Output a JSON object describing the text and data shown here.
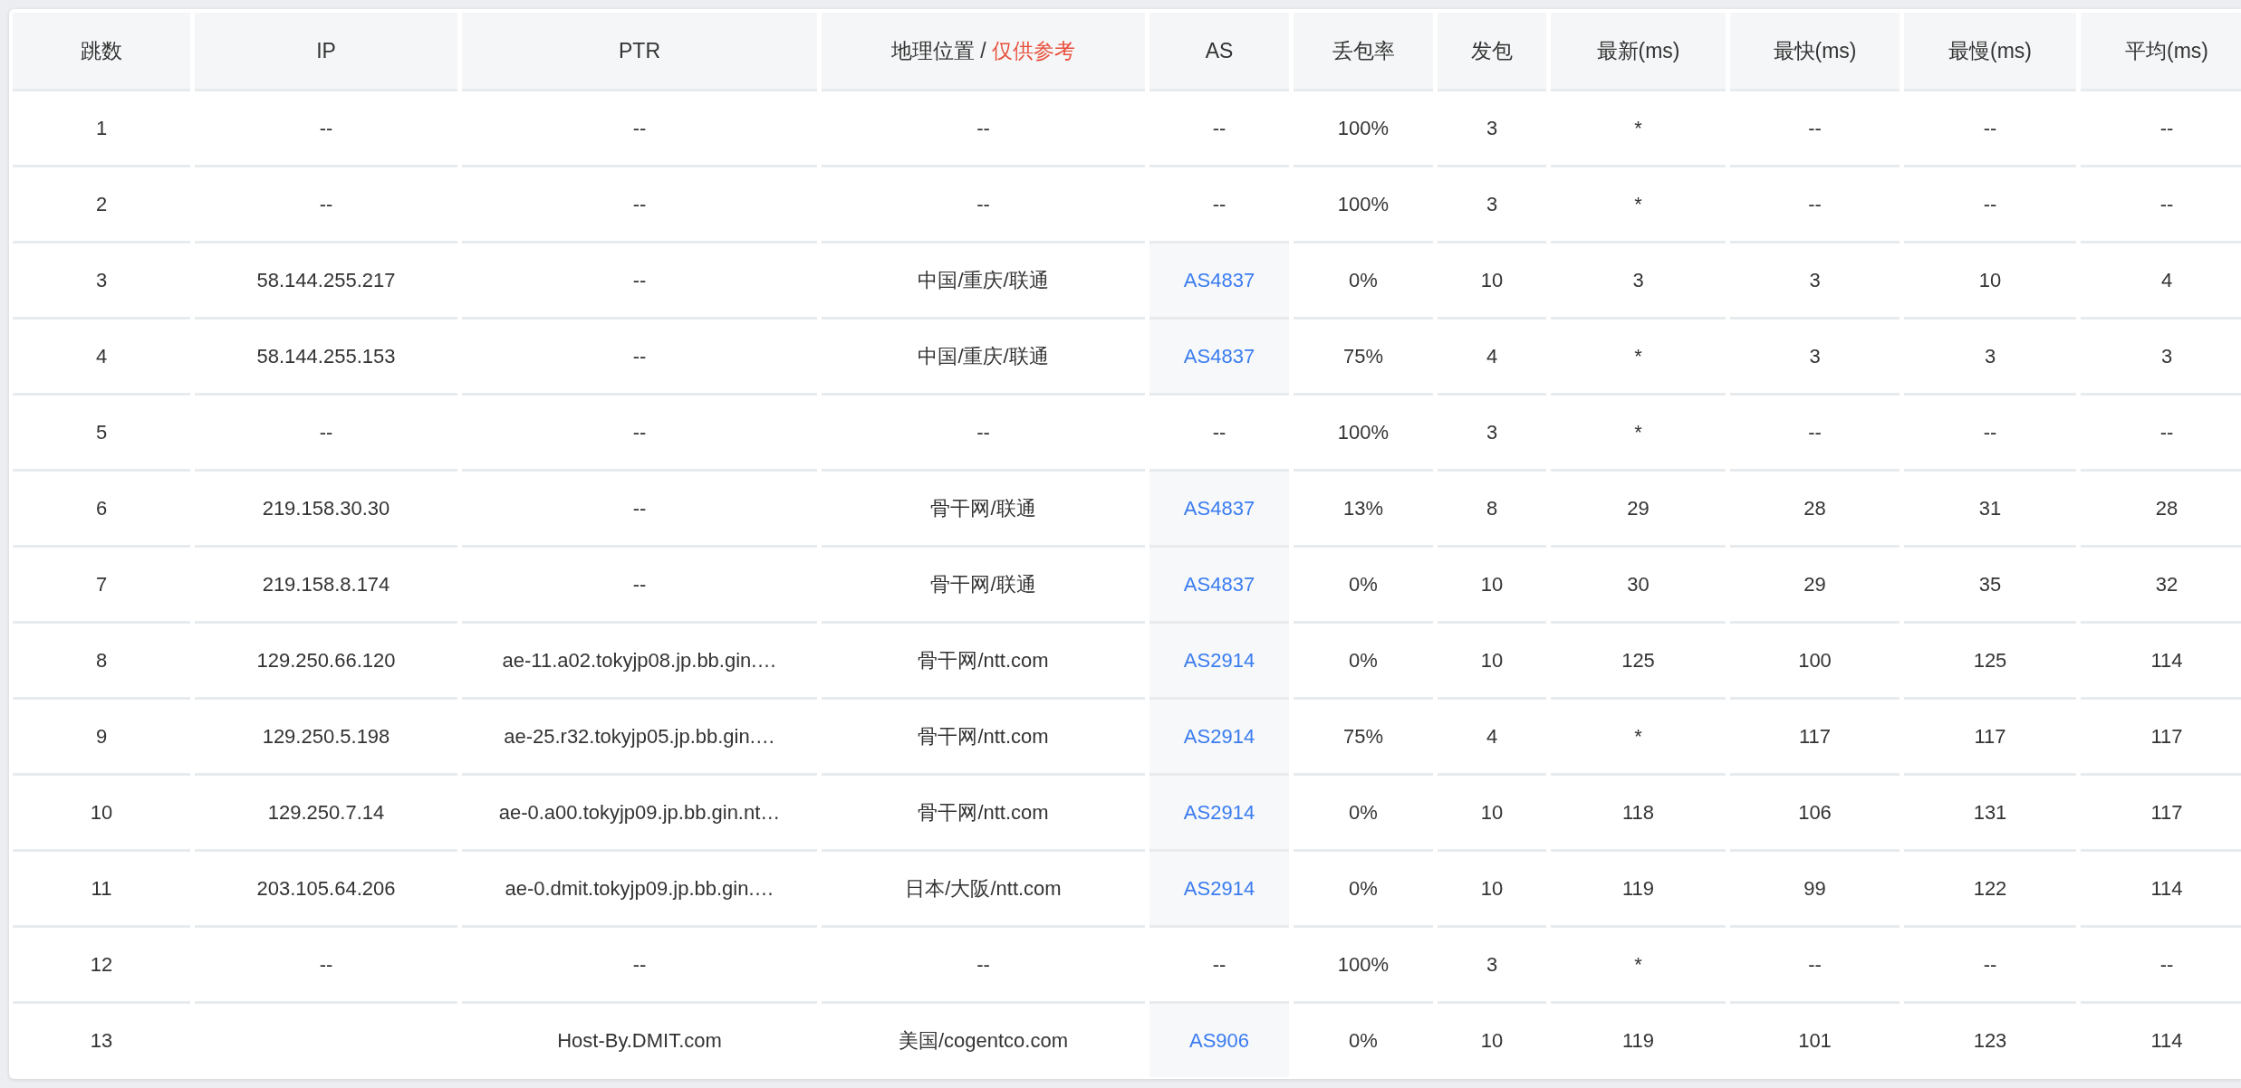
{
  "table": {
    "columns": [
      {
        "label": "跳数"
      },
      {
        "label": "IP"
      },
      {
        "label": "PTR"
      },
      {
        "label": "地理位置 /",
        "note": "仅供参考"
      },
      {
        "label": "AS"
      },
      {
        "label": "丢包率"
      },
      {
        "label": "发包"
      },
      {
        "label": "最新(ms)"
      },
      {
        "label": "最快(ms)"
      },
      {
        "label": "最慢(ms)"
      },
      {
        "label": "平均(ms)"
      }
    ],
    "rows": [
      {
        "hop": "1",
        "ip": "--",
        "ptr": "--",
        "geo": "--",
        "as": {
          "text": "--",
          "link": false
        },
        "loss": "100%",
        "sent": "3",
        "last": "*",
        "best": "--",
        "worst": "--",
        "avg": "--"
      },
      {
        "hop": "2",
        "ip": "--",
        "ptr": "--",
        "geo": "--",
        "as": {
          "text": "--",
          "link": false
        },
        "loss": "100%",
        "sent": "3",
        "last": "*",
        "best": "--",
        "worst": "--",
        "avg": "--"
      },
      {
        "hop": "3",
        "ip": "58.144.255.217",
        "ptr": "--",
        "geo": "中国/重庆/联通",
        "as": {
          "text": "AS4837",
          "link": true
        },
        "loss": "0%",
        "sent": "10",
        "last": "3",
        "best": "3",
        "worst": "10",
        "avg": "4"
      },
      {
        "hop": "4",
        "ip": "58.144.255.153",
        "ptr": "--",
        "geo": "中国/重庆/联通",
        "as": {
          "text": "AS4837",
          "link": true
        },
        "loss": "75%",
        "sent": "4",
        "last": "*",
        "best": "3",
        "worst": "3",
        "avg": "3"
      },
      {
        "hop": "5",
        "ip": "--",
        "ptr": "--",
        "geo": "--",
        "as": {
          "text": "--",
          "link": false
        },
        "loss": "100%",
        "sent": "3",
        "last": "*",
        "best": "--",
        "worst": "--",
        "avg": "--"
      },
      {
        "hop": "6",
        "ip": "219.158.30.30",
        "ptr": "--",
        "geo": "骨干网/联通",
        "as": {
          "text": "AS4837",
          "link": true
        },
        "loss": "13%",
        "sent": "8",
        "last": "29",
        "best": "28",
        "worst": "31",
        "avg": "28"
      },
      {
        "hop": "7",
        "ip": "219.158.8.174",
        "ptr": "--",
        "geo": "骨干网/联通",
        "as": {
          "text": "AS4837",
          "link": true
        },
        "loss": "0%",
        "sent": "10",
        "last": "30",
        "best": "29",
        "worst": "35",
        "avg": "32"
      },
      {
        "hop": "8",
        "ip": "129.250.66.120",
        "ptr": "ae-11.a02.tokyjp08.jp.bb.gin.…",
        "geo": "骨干网/ntt.com",
        "as": {
          "text": "AS2914",
          "link": true
        },
        "loss": "0%",
        "sent": "10",
        "last": "125",
        "best": "100",
        "worst": "125",
        "avg": "114"
      },
      {
        "hop": "9",
        "ip": "129.250.5.198",
        "ptr": "ae-25.r32.tokyjp05.jp.bb.gin.…",
        "geo": "骨干网/ntt.com",
        "as": {
          "text": "AS2914",
          "link": true
        },
        "loss": "75%",
        "sent": "4",
        "last": "*",
        "best": "117",
        "worst": "117",
        "avg": "117"
      },
      {
        "hop": "10",
        "ip": "129.250.7.14",
        "ptr": "ae-0.a00.tokyjp09.jp.bb.gin.nt…",
        "geo": "骨干网/ntt.com",
        "as": {
          "text": "AS2914",
          "link": true
        },
        "loss": "0%",
        "sent": "10",
        "last": "118",
        "best": "106",
        "worst": "131",
        "avg": "117"
      },
      {
        "hop": "11",
        "ip": "203.105.64.206",
        "ptr": "ae-0.dmit.tokyjp09.jp.bb.gin.…",
        "geo": "日本/大阪/ntt.com",
        "as": {
          "text": "AS2914",
          "link": true
        },
        "loss": "0%",
        "sent": "10",
        "last": "119",
        "best": "99",
        "worst": "122",
        "avg": "114"
      },
      {
        "hop": "12",
        "ip": "--",
        "ptr": "--",
        "geo": "--",
        "as": {
          "text": "--",
          "link": false
        },
        "loss": "100%",
        "sent": "3",
        "last": "*",
        "best": "--",
        "worst": "--",
        "avg": "--"
      },
      {
        "hop": "13",
        "ptr": "Host-By.DMIT.com",
        "geo": "美国/cogentco.com",
        "as": {
          "text": "AS906",
          "link": true
        },
        "loss": "0%",
        "sent": "10",
        "last": "119",
        "best": "101",
        "worst": "123",
        "avg": "114"
      }
    ]
  }
}
